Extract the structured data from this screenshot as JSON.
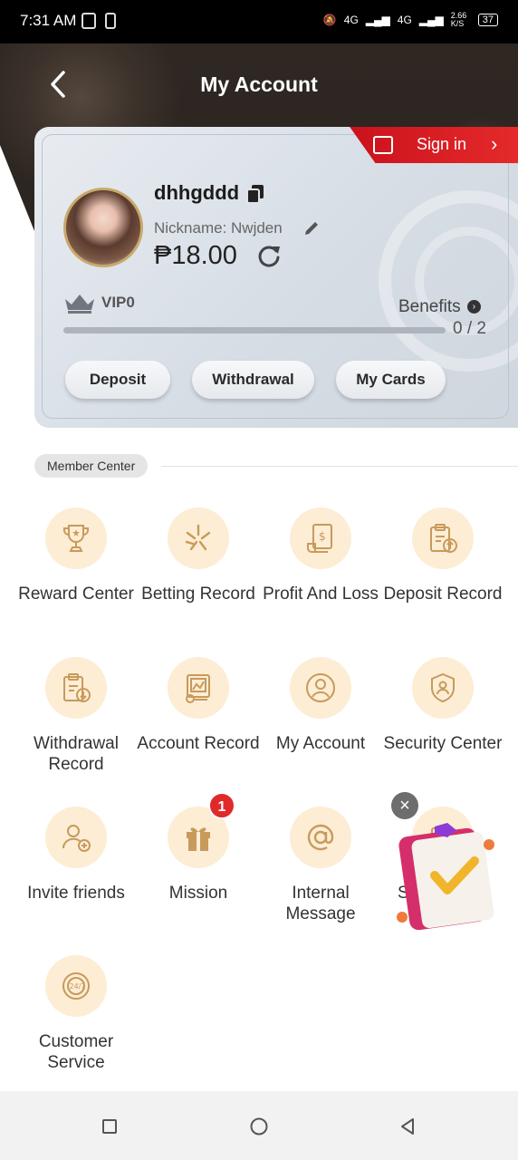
{
  "status_bar": {
    "time": "7:31 AM",
    "net1": "4G",
    "net2": "4G",
    "speed": "2.66 K/S",
    "battery": "37"
  },
  "header": {
    "title": "My Account"
  },
  "sign_in": {
    "label": "Sign in"
  },
  "profile": {
    "username": "dhhgddd",
    "nickname": "Nickname: Nwjden",
    "balance": "₱18.00",
    "vip_level": "VIP0",
    "benefits_label": "Benefits",
    "progress_text": "0 / 2",
    "progress_fraction": 0
  },
  "actions": [
    {
      "label": "Deposit"
    },
    {
      "label": "Withdrawal"
    },
    {
      "label": "My Cards"
    }
  ],
  "member_center": {
    "title": "Member Center",
    "items": [
      {
        "label": "Reward Center",
        "icon": "trophy-icon"
      },
      {
        "label": "Betting Record",
        "icon": "betting-icon"
      },
      {
        "label": "Profit And Loss",
        "icon": "profit-icon"
      },
      {
        "label": "Deposit Record",
        "icon": "deposit-record-icon"
      },
      {
        "label": "Withdrawal Record",
        "icon": "withdrawal-record-icon"
      },
      {
        "label": "Account Record",
        "icon": "account-record-icon"
      },
      {
        "label": "My Account",
        "icon": "user-icon"
      },
      {
        "label": "Security Center",
        "icon": "shield-icon"
      },
      {
        "label": "Invite friends",
        "icon": "invite-icon"
      },
      {
        "label": "Mission",
        "icon": "gift-icon",
        "badge": "1"
      },
      {
        "label": "Internal Message",
        "icon": "at-icon"
      },
      {
        "label": "S",
        "icon": "settings-icon"
      },
      {
        "label": "Customer Service",
        "icon": "support-24-7-icon"
      }
    ]
  },
  "colors": {
    "accent_gold": "#c9a96b",
    "icon_bg": "#fcedd4",
    "sign_in_red": "#d8181f",
    "badge_red": "#e02a2a"
  }
}
